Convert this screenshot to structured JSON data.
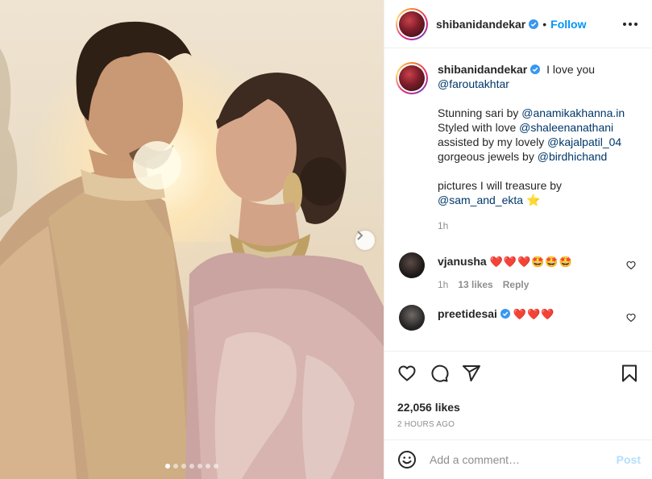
{
  "post": {
    "username": "shibanidandekar",
    "follow_label": "Follow",
    "separator": "•",
    "carousel_count": 7,
    "carousel_active": 0
  },
  "caption": {
    "username": "shibanidandekar",
    "lines": [
      {
        "text": "I love you"
      },
      {
        "mention": "@faroutakhtar"
      },
      {
        "blank": true
      },
      {
        "text": "Stunning sari by ",
        "mention": "@anamikakhanna.in"
      },
      {
        "text": "Styled with love ",
        "mention": "@shaleenanathani"
      },
      {
        "text": "assisted by my lovely ",
        "mention": "@kajalpatil_04"
      },
      {
        "text": "gorgeous jewels by ",
        "mention": "@birdhichand"
      },
      {
        "blank": true
      },
      {
        "text": "pictures I will treasure by"
      },
      {
        "mention": "@sam_and_ekta",
        "emoji": "⭐"
      }
    ],
    "time": "1h"
  },
  "comments": [
    {
      "username": "vjanusha",
      "text": "❤️❤️❤️🤩🤩🤩",
      "time": "1h",
      "likes": "13 likes",
      "reply": "Reply"
    },
    {
      "username": "preetidesai",
      "text": "❤️❤️❤️"
    }
  ],
  "likes_count": "22,056 likes",
  "time_ago": "2 HOURS AGO",
  "add_comment": {
    "placeholder": "Add a comment…",
    "post_label": "Post"
  },
  "colors": {
    "accent": "#0095f6",
    "mention": "#00376b",
    "muted": "#8e8e8e",
    "post_disabled": "#b2dffc"
  },
  "icons": [
    "verified-badge-icon",
    "more-options-icon",
    "heart-icon",
    "comment-icon",
    "share-icon",
    "bookmark-icon",
    "emoji-icon",
    "chevron-right-icon"
  ]
}
